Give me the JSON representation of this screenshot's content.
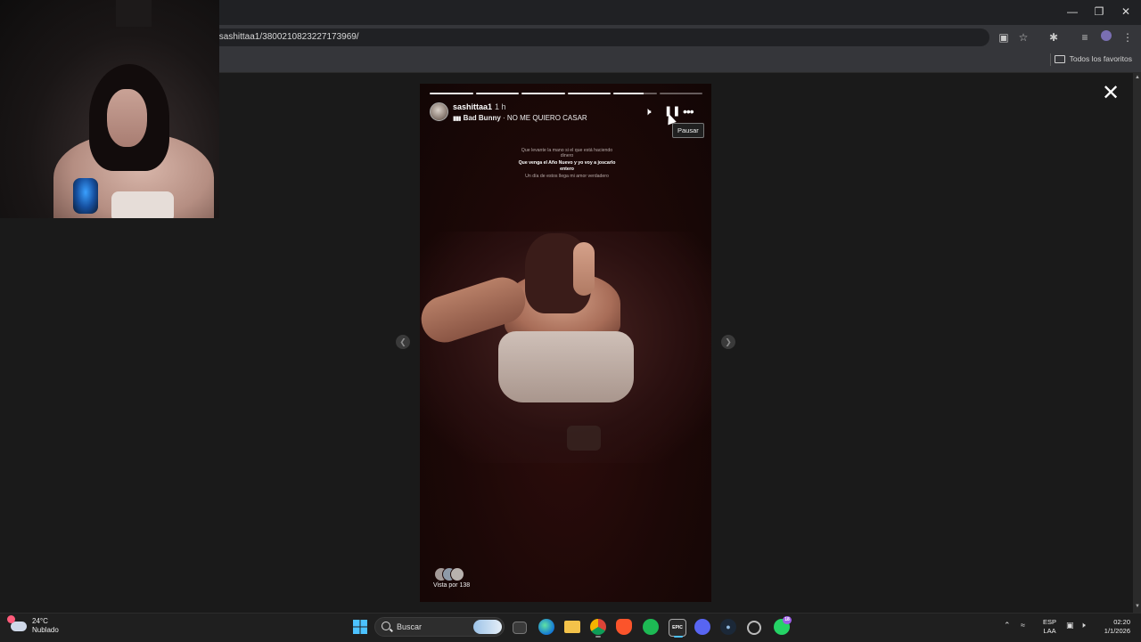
{
  "browser": {
    "url": "/sashittaa1/3800210823227173969/",
    "bookmarks_folder": "Todos los favoritos"
  },
  "story": {
    "username": "sashittaa1",
    "time": "1 h",
    "music_artist": "Bad Bunny",
    "music_separator": " · ",
    "music_title": "NO ME QUIERO CASAR",
    "tooltip": "Pausar",
    "viewed_by": "Vista por 138",
    "progress": {
      "segments": 6,
      "completed": 4,
      "active_fraction": 0.7
    },
    "lyrics": [
      {
        "text": "Que levante la mano si el que está haciendo dinero",
        "style": "dim"
      },
      {
        "text": "Que venga el Año Nuevo y yo voy a joscarlo entero",
        "style": "strong"
      },
      {
        "text": "Un día de estos llega mi amor verdadero",
        "style": "dim"
      }
    ]
  },
  "weather": {
    "temp": "24°C",
    "condition": "Nublado"
  },
  "taskbar": {
    "search_label": "Buscar",
    "language": "ESP",
    "layout": "LAA",
    "time": "02:20",
    "date": "1/1/2026",
    "icons": [
      "windows-start-icon",
      "search-icon",
      "widgets-icon",
      "edge-icon",
      "file-explorer-icon",
      "chrome-icon",
      "brave-icon",
      "spotify-icon",
      "epic-games-icon",
      "discord-icon",
      "steam-icon",
      "settings-app-icon",
      "whatsapp-icon"
    ],
    "badge_count": "18"
  },
  "colors": {
    "accent": "#0a84ff",
    "story_bg": "#1c0807",
    "taskbar": "#1f1f1f"
  }
}
